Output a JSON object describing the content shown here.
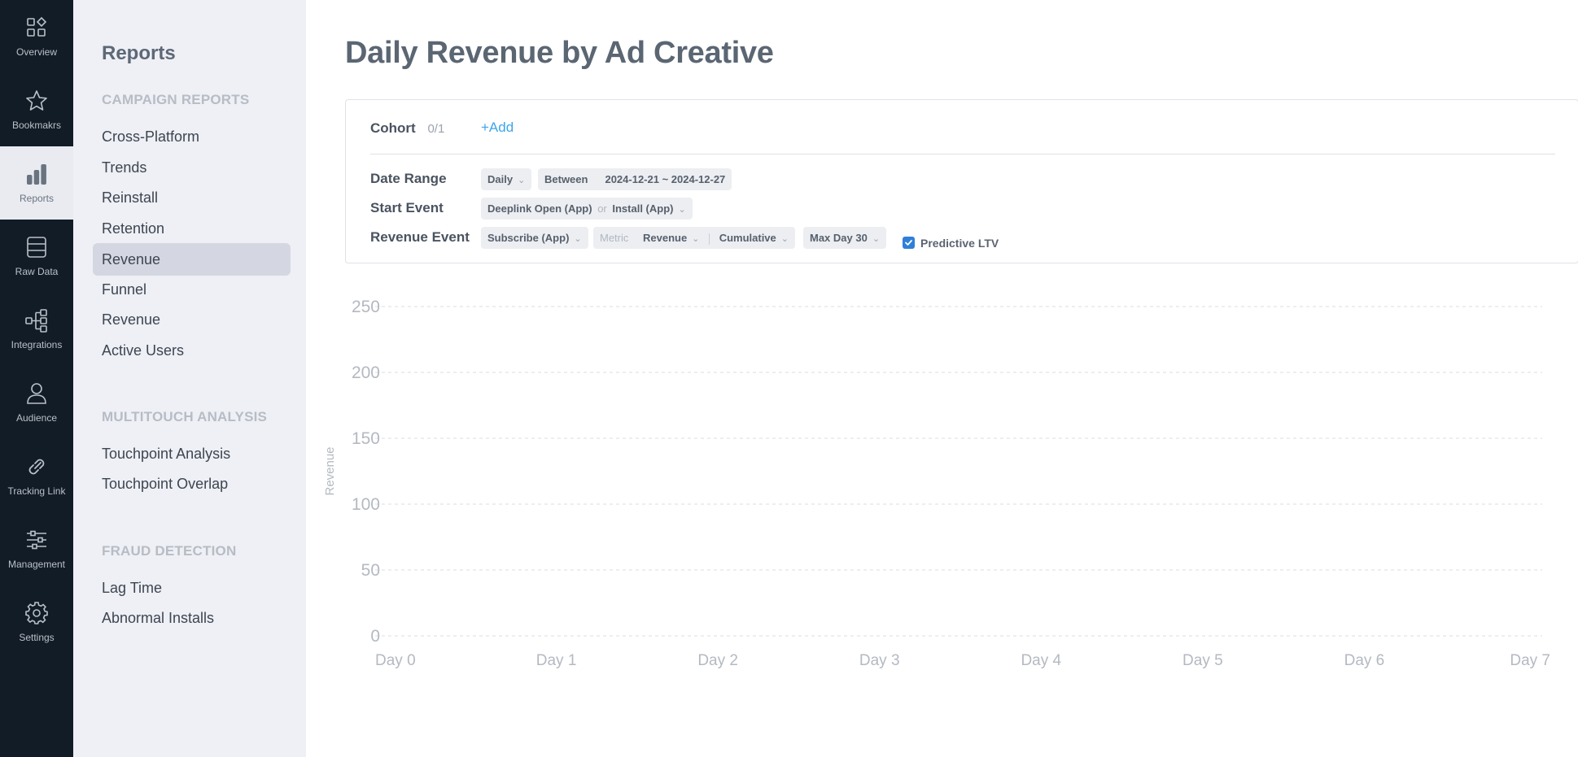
{
  "rail": {
    "items": [
      {
        "label": "Overview",
        "icon": "overview-icon",
        "active": false
      },
      {
        "label": "Bookmakrs",
        "icon": "star-icon",
        "active": false
      },
      {
        "label": "Reports",
        "icon": "bar-chart-icon",
        "active": true
      },
      {
        "label": "Raw Data",
        "icon": "database-icon",
        "active": false
      },
      {
        "label": "Integrations",
        "icon": "integrations-icon",
        "active": false
      },
      {
        "label": "Audience",
        "icon": "person-icon",
        "active": false
      },
      {
        "label": "Tracking Link",
        "icon": "link-icon",
        "active": false
      },
      {
        "label": "Management",
        "icon": "sliders-icon",
        "active": false
      },
      {
        "label": "Settings",
        "icon": "gear-icon",
        "active": false
      }
    ]
  },
  "sidebar": {
    "title": "Reports",
    "sections": [
      {
        "heading": "CAMPAIGN REPORTS",
        "items": [
          "Cross-Platform",
          "Trends",
          "Reinstall",
          "Retention",
          "Revenue",
          "Funnel",
          "Revenue",
          "Active Users"
        ]
      },
      {
        "heading": "MULTITOUCH ANALYSIS",
        "items": [
          "Touchpoint Analysis",
          "Touchpoint Overlap"
        ]
      },
      {
        "heading": "FRAUD DETECTION",
        "items": [
          "Lag Time",
          "Abnormal Installs"
        ]
      }
    ],
    "active_item": "Revenue"
  },
  "page": {
    "title": "Daily Revenue by Ad Creative"
  },
  "filters": {
    "cohort": {
      "label": "Cohort",
      "count": "0/1",
      "add": "+Add"
    },
    "date_range": {
      "label": "Date Range",
      "granularity": "Daily",
      "between": "Between",
      "range": "2024-12-21 ~ 2024-12-27"
    },
    "start_event": {
      "label": "Start Event",
      "event_a": "Deeplink Open (App)",
      "or": "or",
      "event_b": "Install (App)"
    },
    "revenue_event": {
      "label": "Revenue Event",
      "event": "Subscribe (App)",
      "metric_label": "Metric",
      "metric": "Revenue",
      "mode": "Cumulative",
      "max_day": "Max Day 30",
      "predictive_ltv": "Predictive LTV",
      "predictive_checked": true
    }
  },
  "colors": {
    "rail_bg": "#121c26",
    "sidebar_bg": "#eef0f5",
    "accent": "#3ea5e8",
    "checkbox": "#2f7fd8"
  },
  "chart_data": {
    "type": "line",
    "title": "",
    "xlabel": "",
    "ylabel": "Revenue",
    "categories": [
      "Day 0",
      "Day 1",
      "Day 2",
      "Day 3",
      "Day 4",
      "Day 5",
      "Day 6",
      "Day 7"
    ],
    "y_ticks": [
      0,
      50,
      100,
      150,
      200,
      250
    ],
    "ylim": [
      0,
      250
    ],
    "grid": true,
    "series": []
  }
}
